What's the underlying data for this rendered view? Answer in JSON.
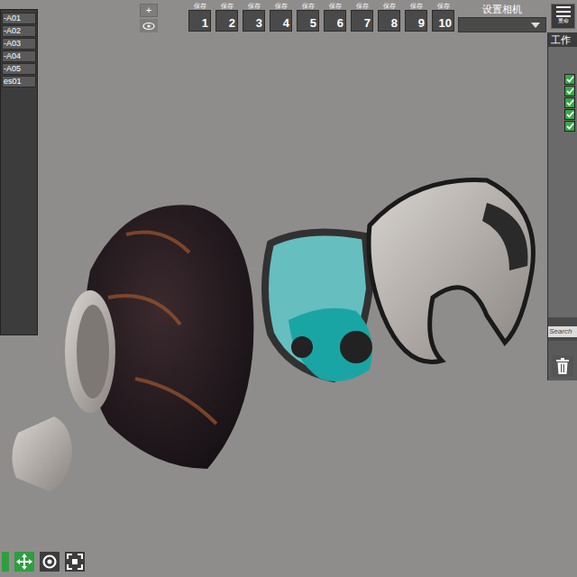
{
  "model_list": {
    "items": [
      "-A01",
      "-A02",
      "-A03",
      "-A04",
      "-A05",
      "es01"
    ]
  },
  "view_buttons": {
    "add": "+"
  },
  "save_slots": [
    {
      "label": "保存",
      "number": "1"
    },
    {
      "label": "保存",
      "number": "2"
    },
    {
      "label": "保存",
      "number": "3"
    },
    {
      "label": "保存",
      "number": "4"
    },
    {
      "label": "保存",
      "number": "5"
    },
    {
      "label": "保存",
      "number": "6"
    },
    {
      "label": "保存",
      "number": "7"
    },
    {
      "label": "保存",
      "number": "8"
    },
    {
      "label": "保存",
      "number": "9"
    },
    {
      "label": "保存",
      "number": "10"
    }
  ],
  "camera": {
    "label": "设置相机"
  },
  "right_panel": {
    "menu_label": "重命",
    "title": "工作",
    "layers": [
      {
        "checked": true
      },
      {
        "checked": true
      },
      {
        "checked": true
      },
      {
        "checked": true
      },
      {
        "checked": true
      }
    ],
    "search": {
      "placeholder": "Search"
    }
  }
}
